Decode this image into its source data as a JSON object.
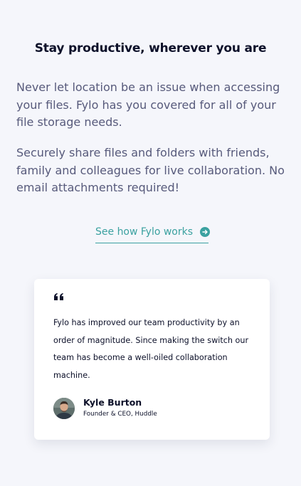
{
  "productive": {
    "heading": "Stay productive, wherever you are",
    "paragraph_1": "Never let location be an issue when accessing your files. Fylo has you covered for all of your file storage needs.",
    "paragraph_2": "Securely share files and folders with friends, family and colleagues for live collaboration. No email attachments required!",
    "cta": {
      "label": "See how Fylo works",
      "icon": "arrow-circle-right-icon"
    }
  },
  "testimonial": {
    "quote_icon": "quote-icon",
    "quote": "Fylo has improved our team productivity by an order of magnitude. Since making the switch our team has become a well-oiled collaboration machine.",
    "author": {
      "name": "Kyle Burton",
      "title": "Founder & CEO, Huddle",
      "avatar_icon": "avatar"
    }
  },
  "colors": {
    "background": "#f5f6fb",
    "heading": "#0c1029",
    "body_text": "#575a7b",
    "accent": "#3ba1a0",
    "card": "#ffffff"
  }
}
